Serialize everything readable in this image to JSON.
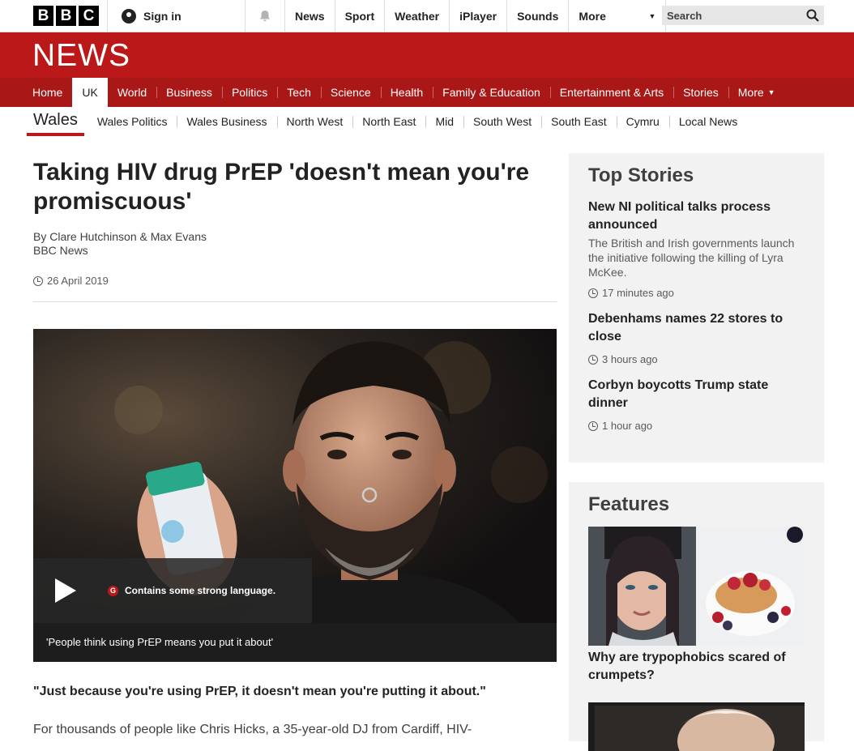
{
  "bbc_bar": {
    "logo_letters": [
      "B",
      "B",
      "C"
    ],
    "signin": "Sign in",
    "nav": [
      "News",
      "Sport",
      "Weather",
      "iPlayer",
      "Sounds"
    ],
    "more": "More",
    "search_placeholder": "Search"
  },
  "news_logo": "NEWS",
  "section_nav": {
    "items": [
      "Home",
      "UK",
      "World",
      "Business",
      "Politics",
      "Tech",
      "Science",
      "Health",
      "Family & Education",
      "Entertainment & Arts",
      "Stories",
      "More"
    ],
    "active": "UK"
  },
  "sub_nav": {
    "region": "Wales",
    "items": [
      "Wales Politics",
      "Wales Business",
      "North West",
      "North East",
      "Mid",
      "South West",
      "South East",
      "Cymru",
      "Local News"
    ]
  },
  "article": {
    "headline": "Taking HIV drug PrEP 'doesn't mean you're promiscuous'",
    "authors": "By Clare Hutchinson & Max Evans",
    "source": "BBC News",
    "date": "26 April 2019",
    "media": {
      "guidance_badge": "G",
      "guidance": "Contains some strong language.",
      "caption": "'People think using PrEP means you put it about'"
    },
    "quote": "\"Just because you're using PrEP, it doesn't mean you're putting it about.\"",
    "paragraph": "For thousands of people like Chris Hicks, a 35-year-old DJ from Cardiff, HIV-"
  },
  "top_stories": {
    "heading": "Top Stories",
    "items": [
      {
        "title": "New NI political talks process announced",
        "summary": "The British and Irish governments launch the initiative following the killing of Lyra McKee.",
        "time": "17 minutes ago"
      },
      {
        "title": "Debenhams names 22 stores to close",
        "summary": "",
        "time": "3 hours ago"
      },
      {
        "title": "Corbyn boycotts Trump state dinner",
        "summary": "",
        "time": "1 hour ago"
      }
    ]
  },
  "features": {
    "heading": "Features",
    "items": [
      {
        "title": "Why are trypophobics scared of crumpets?"
      }
    ]
  }
}
